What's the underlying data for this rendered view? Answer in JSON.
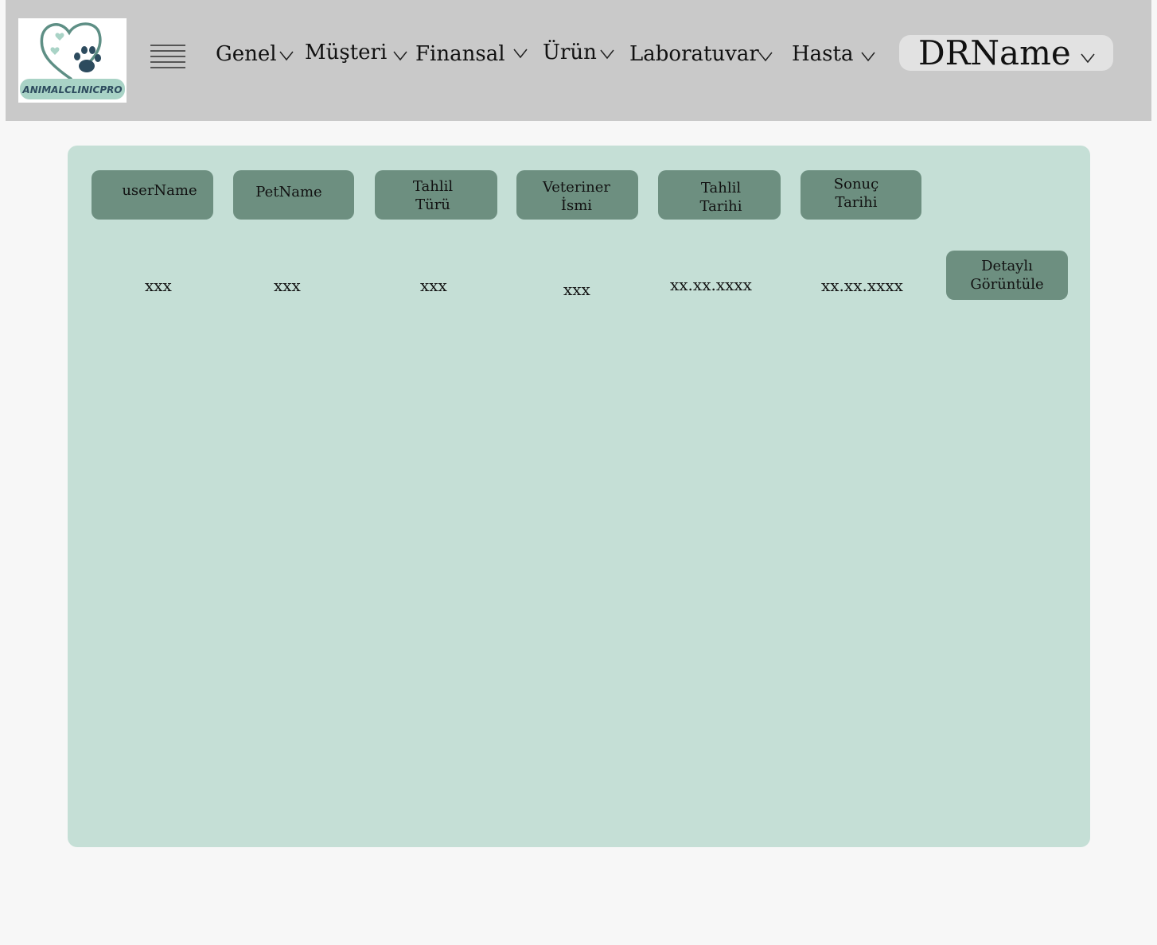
{
  "header": {
    "logo_text": "ANIMALCLINICPRO",
    "nav": [
      {
        "label": "Genel"
      },
      {
        "label": "Müşteri"
      },
      {
        "label": "Finansal"
      },
      {
        "label": "Ürün"
      },
      {
        "label": "Laboratuvar"
      },
      {
        "label": "Hasta"
      }
    ],
    "user_name": "DRName"
  },
  "table": {
    "columns": [
      "userName",
      "PetName",
      "Tahlil\nTürü",
      "Veteriner\nİsmi",
      "Tahlil\nTarihi",
      "Sonuç\nTarihi"
    ],
    "rows": [
      {
        "cells": [
          "xxx",
          "xxx",
          "xxx",
          "xxx",
          "xx.xx.xxxx",
          "xx.xx.xxxx"
        ],
        "action_label": "Detaylı\nGörüntüle"
      }
    ]
  },
  "colors": {
    "topbar": "#c9c9c9",
    "panel": "#c5dfd6",
    "button": "#6d8f80",
    "user_menu": "#e2e2e2",
    "logo_heart": "#5e8f85",
    "logo_paw": "#2d4b5e",
    "logo_band": "#a9d3c6"
  }
}
